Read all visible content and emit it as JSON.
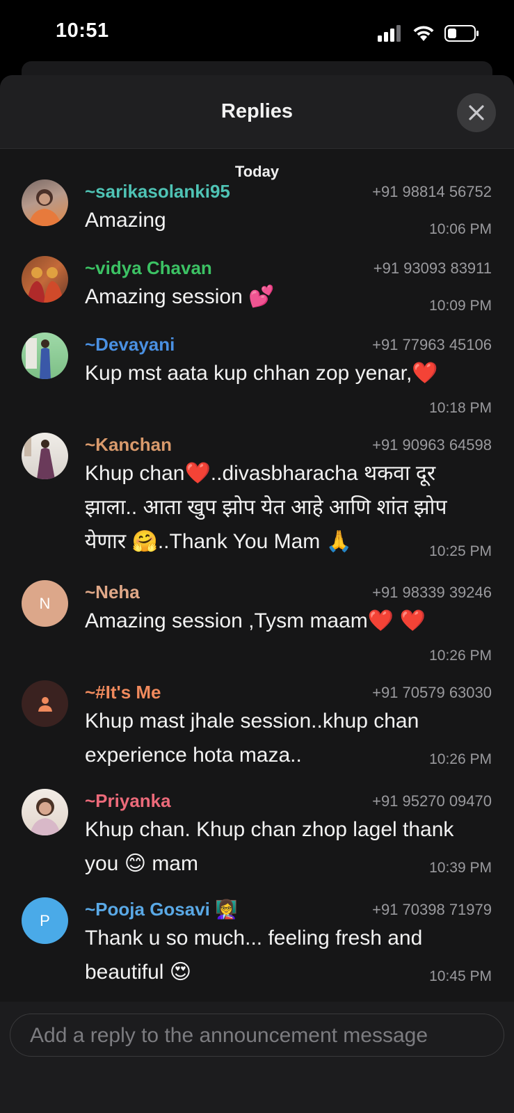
{
  "status_bar": {
    "time": "10:51"
  },
  "header": {
    "title": "Replies"
  },
  "day_label": "Today",
  "replies": [
    {
      "sender": "~sarikasolanki95",
      "phone": "+91 98814 56752",
      "message": "Amazing",
      "time": "10:06 PM",
      "name_color": "#4fc3b5"
    },
    {
      "sender": "~vidya Chavan",
      "phone": "+91 93093 83911",
      "message": "Amazing session 💕",
      "time": "10:09 PM",
      "name_color": "#3cc264"
    },
    {
      "sender": "~Devayani",
      "phone": "+91 77963 45106",
      "message": "Kup mst aata kup chhan zop yenar,❤️",
      "time": "10:18 PM",
      "name_color": "#4a90e2"
    },
    {
      "sender": "~Kanchan",
      "phone": "+91 90963 64598",
      "message": "Khup chan❤️..divasbharacha थकवा दूर झाला.. आता खुप झोप येत आहे आणि शांत झोप येणार 🤗..Thank You Mam 🙏",
      "time": "10:25 PM",
      "name_color": "#d99a6c"
    },
    {
      "sender": "~Neha",
      "phone": "+91 98339 39246",
      "message": "Amazing session ,Tysm maam❤️ ❤️",
      "time": "10:26 PM",
      "name_color": "#e0a888",
      "avatar_letter": "N"
    },
    {
      "sender": "~#It's Me",
      "phone": "+91 70579 63030",
      "message": "Khup mast jhale session..khup chan experience hota maza..",
      "time": "10:26 PM",
      "name_color": "#f08a5d"
    },
    {
      "sender": "~Priyanka",
      "phone": "+91 95270 09470",
      "message": "Khup chan. Khup chan zhop lagel thank you 😊 mam",
      "time": "10:39 PM",
      "name_color": "#ec6a7a"
    },
    {
      "sender": "~Pooja Gosavi 👩‍🏫",
      "phone": "+91 70398 71979",
      "message": "Thank u so much... feeling fresh and beautiful 😍",
      "time": "10:45 PM",
      "name_color": "#5aa9e6",
      "avatar_letter": "P"
    }
  ],
  "composer": {
    "placeholder": "Add a reply to the announcement message"
  }
}
